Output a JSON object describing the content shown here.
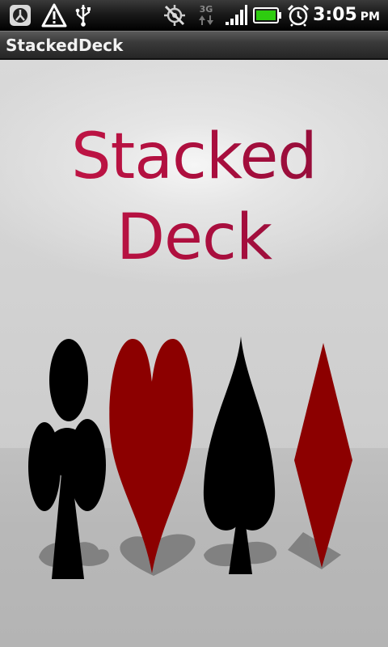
{
  "status_bar": {
    "time": "3:05",
    "ampm": "PM",
    "network_type": "3G",
    "icons": [
      "app-notification-icon",
      "warning-icon",
      "usb-icon",
      "gps-off-icon",
      "data-3g-icon",
      "signal-icon",
      "battery-icon",
      "alarm-icon"
    ]
  },
  "app_bar": {
    "title": "StackedDeck"
  },
  "splash": {
    "title": "Stacked Deck",
    "suits": [
      "club",
      "heart",
      "spade",
      "diamond"
    ],
    "colors": {
      "title": "#b01040",
      "red_suit": "#8c0000",
      "black_suit": "#000000",
      "background": "#d4d4d4"
    }
  }
}
